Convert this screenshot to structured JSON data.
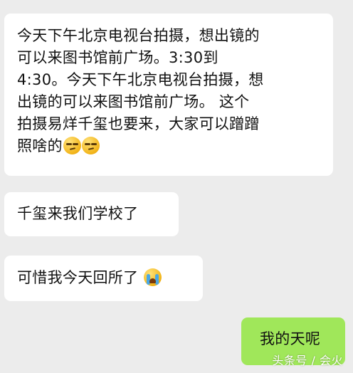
{
  "messages": [
    {
      "direction": "incoming",
      "lines": [
        "今天下午北京电视台拍摄，想出镜的",
        "可以来图书馆前广场。3:30到",
        "4:30。今天下午北京电视台拍摄，想",
        "出镜的可以来图书馆前广场。 这个",
        "拍摄易烊千玺也要来，大家可以蹭蹭",
        "照啥的"
      ],
      "emojis": [
        "smug-face-icon",
        "smug-face-icon"
      ]
    },
    {
      "direction": "incoming",
      "text": "千玺来我们学校了"
    },
    {
      "direction": "incoming",
      "text": "可惜我今天回所了",
      "emojis": [
        "crying-face-icon"
      ]
    },
    {
      "direction": "outgoing",
      "text": "我的天呢"
    }
  ],
  "watermark": "头条号 / 会火",
  "colors": {
    "background": "#ececec",
    "incoming_bubble": "#ffffff",
    "outgoing_bubble": "#a0e75a"
  }
}
